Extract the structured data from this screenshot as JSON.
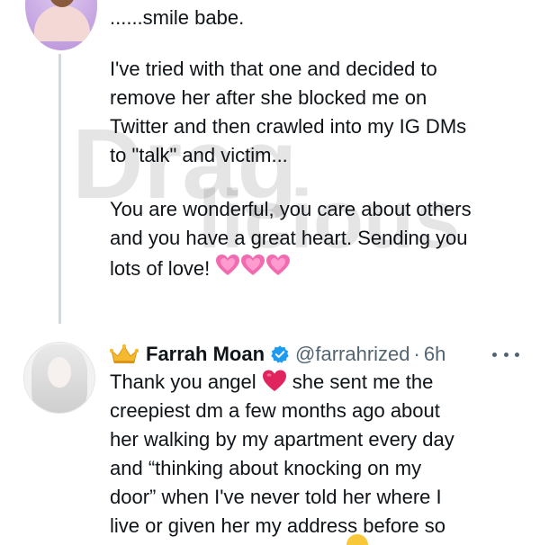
{
  "reply_tweet": {
    "line_1": "......smile babe.",
    "paragraph_2": "I've tried with that one and decided to\nremove her after she blocked me on\nTwitter and then crawled into my IG DMs\nto \"talk\" and victim...",
    "paragraph_3": "You are wonderful, you care about others\nand you have a great heart. Sending you\nlots of love!",
    "emoji_count": 3
  },
  "response_tweet": {
    "display_name": "Farrah Moan",
    "handle": "@farrahrized",
    "separator": "·",
    "time": "6h",
    "text_start": "Thank you angel",
    "text_rest": "she sent me the\ncreepiest dm a few months ago about\nher walking by my apartment every day\nand “thinking about knocking on my\ndoor” when I've never told her where I\nlive or given her my address before so",
    "badges": [
      "crown-icon",
      "verified-badge-icon"
    ]
  },
  "watermark": {
    "line_1": "Drag",
    "line_2": "licious"
  },
  "colors": {
    "text": "#0f1419",
    "secondary": "#536471",
    "thread_line": "#cfd9de",
    "verified": "#1d9bf0",
    "heart_pink": "#f06bb0",
    "heart_red": "#e0245e"
  }
}
